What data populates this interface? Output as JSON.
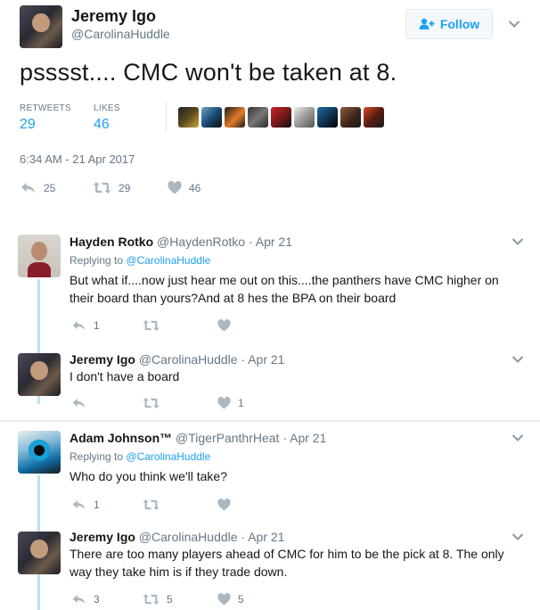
{
  "main_tweet": {
    "author_name": "Jeremy Igo",
    "author_handle": "@CarolinaHuddle",
    "follow_label": "Follow",
    "text": "psssst.... CMC won't be taken at 8.",
    "retweets_label": "RETWEETS",
    "retweets_count": "29",
    "likes_label": "LIKES",
    "likes_count": "46",
    "timestamp": "6:34 AM - 21 Apr 2017",
    "actions": {
      "reply_count": "25",
      "retweet_count": "29",
      "like_count": "46"
    }
  },
  "replies": [
    {
      "author_name": "Hayden Rotko",
      "author_handle": "@HaydenRotko",
      "date": "· Apr 21",
      "replying_prefix": "Replying to",
      "replying_to": "@CarolinaHuddle",
      "text": "But what if....now just hear me out on this....the panthers have CMC higher on their board than yours?And at 8 hes the BPA on their board",
      "reply_count": "1",
      "retweet_count": "",
      "like_count": ""
    },
    {
      "author_name": "Jeremy Igo",
      "author_handle": "@CarolinaHuddle",
      "date": "· Apr 21",
      "text": "I don't have a board",
      "reply_count": "",
      "retweet_count": "",
      "like_count": "1"
    },
    {
      "author_name": "Adam Johnson™",
      "author_handle": "@TigerPanthrHeat",
      "date": "· Apr 21",
      "replying_prefix": "Replying to",
      "replying_to": "@CarolinaHuddle",
      "text": "Who do you think we'll take?",
      "reply_count": "1",
      "retweet_count": "",
      "like_count": ""
    },
    {
      "author_name": "Jeremy Igo",
      "author_handle": "@CarolinaHuddle",
      "date": "· Apr 21",
      "text": "There are too many players ahead of CMC for him to be the pick at 8. The only way they take him is if they trade down.",
      "reply_count": "3",
      "retweet_count": "5",
      "like_count": "5"
    }
  ],
  "colors": {
    "accent": "#1da1f2",
    "muted": "#657786",
    "text": "#14171a",
    "thread_line": "#b8e3f5"
  },
  "icons": [
    "follow-user-icon",
    "chevron-down-icon",
    "reply-icon",
    "retweet-icon",
    "heart-icon"
  ]
}
